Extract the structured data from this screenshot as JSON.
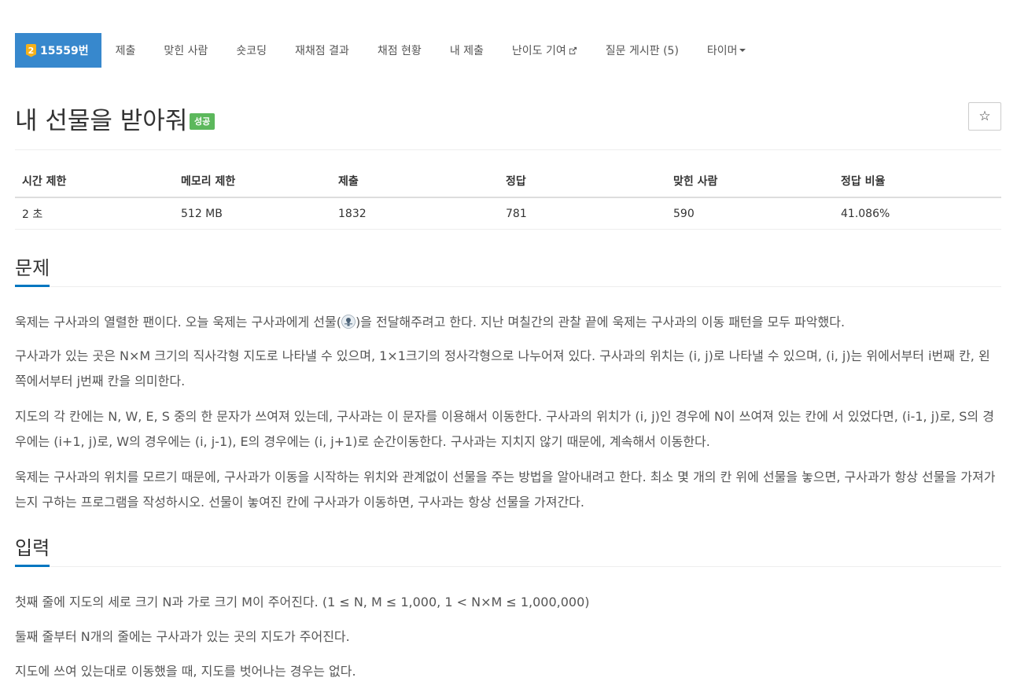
{
  "nav": {
    "problem_number": "15559번",
    "tier_label": "2",
    "items": [
      {
        "label": "제출"
      },
      {
        "label": "맞힌 사람"
      },
      {
        "label": "숏코딩"
      },
      {
        "label": "재채점 결과"
      },
      {
        "label": "채점 현황"
      },
      {
        "label": "내 제출"
      },
      {
        "label": "난이도 기여"
      },
      {
        "label": "질문 게시판 (5)"
      },
      {
        "label": "타이머"
      }
    ]
  },
  "title": "내 선물을 받아줘",
  "status_badge": "성공",
  "star_symbol": "☆",
  "info_table": {
    "headers": [
      "시간 제한",
      "메모리 제한",
      "제출",
      "정답",
      "맞힌 사람",
      "정답 비율"
    ],
    "values": [
      "2 초",
      "512 MB",
      "1832",
      "781",
      "590",
      "41.086%"
    ]
  },
  "sections": {
    "problem": {
      "title": "문제",
      "p1_before": "욱제는 구사과의 열렬한 팬이다. 오늘 욱제는 구사과에게 선물(",
      "p1_after": ")을 전달해주려고 한다. 지난 며칠간의 관찰 끝에 욱제는 구사과의 이동 패턴을 모두 파악했다.",
      "p2": "구사과가 있는 곳은 N×M 크기의 직사각형 지도로 나타낼 수 있으며, 1×1크기의 정사각형으로 나누어져 있다. 구사과의 위치는 (i, j)로 나타낼 수 있으며, (i, j)는 위에서부터 i번째 칸, 왼쪽에서부터 j번째 칸을 의미한다.",
      "p3": "지도의 각 칸에는 N, W, E, S 중의 한 문자가 쓰여져 있는데, 구사과는 이 문자를 이용해서 이동한다. 구사과의 위치가 (i, j)인 경우에 N이 쓰여져 있는 칸에 서 있었다면, (i-1, j)로, S의 경우에는 (i+1, j)로, W의 경우에는 (i, j-1), E의 경우에는 (i, j+1)로 순간이동한다. 구사과는 지치지 않기 때문에, 계속해서 이동한다.",
      "p4": "욱제는 구사과의 위치를 모르기 때문에, 구사과가 이동을 시작하는 위치와 관계없이 선물을 주는 방법을 알아내려고 한다. 최소 몇 개의 칸 위에 선물을 놓으면, 구사과가 항상 선물을 가져가는지 구하는 프로그램을 작성하시오. 선물이 놓여진 칸에 구사과가 이동하면, 구사과는 항상 선물을 가져간다."
    },
    "input": {
      "title": "입력",
      "p1": "첫째 줄에 지도의 세로 크기 N과 가로 크기 M이 주어진다. (1 ≤ N, M ≤ 1,000, 1 < N×M ≤ 1,000,000)",
      "p2": "둘째 줄부터 N개의 줄에는 구사과가 있는 곳의 지도가 주어진다.",
      "p3": "지도에 쓰여 있는대로 이동했을 때, 지도를 벗어나는 경우는 없다."
    }
  },
  "colors": {
    "nav_active": "#3788cd",
    "success_badge": "#5cb85c",
    "section_underline": "#0076c0",
    "tier_gold": "#f6b11a"
  }
}
